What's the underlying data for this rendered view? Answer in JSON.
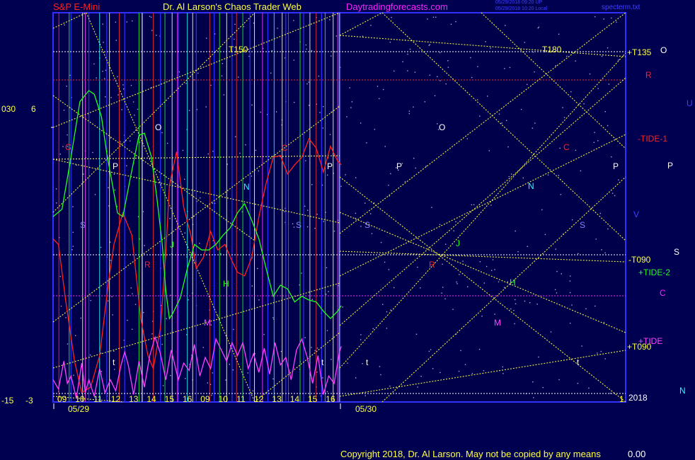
{
  "header": {
    "symbol": "S&P E-Mini",
    "site": "Dr. Al Larson's Chaos Trader Web",
    "url": "Daytradingforecasts.com",
    "stamp1": "05/29/2018 09:20 UP",
    "stamp2": "05/29/2018 10:20 Local",
    "file": "specterm.txt"
  },
  "footer": {
    "copyright": "Copyright 2018, Dr. Al Larson. May not be copied by any means",
    "tail": "0.00"
  },
  "left_axis": {
    "top_a": "030",
    "top_b": "6",
    "bottom_a": "-15",
    "bottom_b": "-3"
  },
  "colors": {
    "background": "#000050",
    "frame": "#3030ff",
    "yellow": "#ffff40",
    "red": "#ff2020",
    "green": "#20ff20",
    "magenta": "#ff20ff",
    "cyan": "#20ffff",
    "white": "#ffffff",
    "pink": "#ff40ff",
    "blue": "#4040ff"
  },
  "chart_data": {
    "type": "line",
    "title": "S&P E-Mini",
    "x_sessions": [
      "05/29",
      "05/30"
    ],
    "hour_ticks": [
      "09",
      "10",
      "11",
      "12",
      "13",
      "14",
      "15",
      "16",
      "09",
      "10",
      "11",
      "12",
      "13",
      "14",
      "15",
      "16"
    ],
    "hline_labels": [
      "T150",
      "T180",
      "+T135",
      "-T090",
      "+T090",
      "2018"
    ],
    "series": [
      {
        "name": "-TIDE-1",
        "color": "#ff2020",
        "x": [
          0,
          0.3,
          0.7,
          1.2,
          1.6,
          2.1,
          2.6,
          3.1,
          3.4,
          3.9,
          4.4,
          4.9,
          5.3,
          5.6,
          6.0,
          6.3,
          6.5,
          6.9,
          7.3,
          7.7,
          8.0,
          8.4,
          8.8,
          9.2,
          9.6,
          10.0,
          10.3,
          10.7,
          11.1,
          11.5,
          11.9,
          12.3,
          12.7,
          13.1,
          13.5,
          13.9,
          14.3,
          14.7,
          15.1,
          15.5,
          15.9,
          16.1
        ],
        "y": [
          -6.2,
          -6.5,
          -9.5,
          -12.8,
          -14.5,
          -14.2,
          -12.5,
          -8.5,
          -6.5,
          -4.8,
          -6.0,
          -10.5,
          -12.5,
          -13.2,
          -11.0,
          -7.0,
          -3.3,
          -1.5,
          -4.5,
          -6.0,
          -7.8,
          -7.2,
          -5.8,
          -6.8,
          -6.5,
          -7.4,
          -8.0,
          -8.2,
          -7.2,
          -5.0,
          -3.2,
          -1.8,
          -1.7,
          -2.7,
          -2.2,
          -1.8,
          -0.8,
          -1.3,
          -2.6,
          -1.2,
          -2.0,
          -2.2
        ]
      },
      {
        "name": "+TIDE-2",
        "color": "#20ff20",
        "x": [
          0,
          0.5,
          1.0,
          1.5,
          2.0,
          2.3,
          2.7,
          3.0,
          3.3,
          3.6,
          3.9,
          4.3,
          4.8,
          5.1,
          5.5,
          5.8,
          6.1,
          6.3,
          6.5,
          6.7,
          7.1,
          7.5,
          7.9,
          8.3,
          8.7,
          9.1,
          9.5,
          9.9,
          10.3,
          10.7,
          11.1,
          11.5,
          11.9,
          12.3,
          12.7,
          13.1,
          13.5,
          13.9,
          14.3,
          14.7,
          15.1,
          15.5,
          15.9,
          16.1
        ],
        "y": [
          -5.0,
          -4.6,
          -1.8,
          1.2,
          1.8,
          1.6,
          0.4,
          -1.6,
          -3.2,
          -4.8,
          -5.0,
          -3.0,
          -0.6,
          -0.5,
          -1.8,
          -4.0,
          -6.5,
          -9.0,
          -10.5,
          -10.2,
          -9.4,
          -7.8,
          -6.5,
          -6.8,
          -6.8,
          -6.5,
          -6.0,
          -5.6,
          -4.8,
          -4.3,
          -5.2,
          -6.2,
          -7.8,
          -9.3,
          -8.7,
          -8.9,
          -9.6,
          -9.3,
          -9.5,
          -9.6,
          -10.1,
          -10.5,
          -10.1,
          -9.8
        ]
      },
      {
        "name": "+TIDE",
        "color": "#ff40ff",
        "x": [
          0,
          0.3,
          0.6,
          0.8,
          1.0,
          1.3,
          1.6,
          1.8,
          2.0,
          2.3,
          2.6,
          2.9,
          3.2,
          3.5,
          3.8,
          4.0,
          4.2,
          4.5,
          4.8,
          5.1,
          5.4,
          5.7,
          6.0,
          6.3,
          6.6,
          6.8,
          7.0,
          7.3,
          7.6,
          7.9,
          8.2,
          8.5,
          8.8,
          9.1,
          9.4,
          9.7,
          10.0,
          10.3,
          10.6,
          10.9,
          11.2,
          11.5,
          11.8,
          12.1,
          12.4,
          12.7,
          13.0,
          13.3,
          13.6,
          13.9,
          14.2,
          14.5,
          14.8,
          15.1,
          15.4,
          15.7,
          16.0,
          16.1
        ],
        "y": [
          -13.8,
          -14.3,
          -12.8,
          -14.0,
          -13.6,
          -14.8,
          -12.9,
          -14.5,
          -13.8,
          -14.7,
          -13.2,
          -14.5,
          -13.8,
          -14.4,
          -13.0,
          -12.3,
          -13.0,
          -14.6,
          -12.8,
          -14.2,
          -12.5,
          -11.5,
          -12.4,
          -13.8,
          -12.2,
          -13.0,
          -13.8,
          -12.9,
          -13.3,
          -11.9,
          -13.6,
          -12.6,
          -13.2,
          -11.6,
          -12.2,
          -12.8,
          -11.8,
          -12.5,
          -11.8,
          -13.2,
          -12.4,
          -13.4,
          -12.1,
          -13.5,
          -11.8,
          -13.0,
          -12.6,
          -13.8,
          -12.2,
          -11.6,
          -12.6,
          -14.0,
          -12.5,
          -14.6,
          -13.6,
          -14.0,
          -12.3,
          -12.0
        ]
      }
    ],
    "ylim": [
      -15,
      6
    ],
    "y2lim": [
      -3,
      30
    ]
  },
  "ring_labels": [
    {
      "text": "C",
      "color": "#ff2020"
    },
    {
      "text": "P",
      "color": "#ffffff"
    },
    {
      "text": "O",
      "color": "#ffffff"
    },
    {
      "text": "S",
      "color": "#8080ff"
    },
    {
      "text": "R",
      "color": "#ff2020"
    },
    {
      "text": "J",
      "color": "#20ff20"
    },
    {
      "text": "H",
      "color": "#20ff20"
    },
    {
      "text": "M",
      "color": "#ff40ff"
    },
    {
      "text": "N",
      "color": "#20ffff"
    },
    {
      "text": "t",
      "color": "#ffffff"
    },
    {
      "text": "V",
      "color": "#4040ff"
    },
    {
      "text": "U",
      "color": "#4040ff"
    }
  ]
}
